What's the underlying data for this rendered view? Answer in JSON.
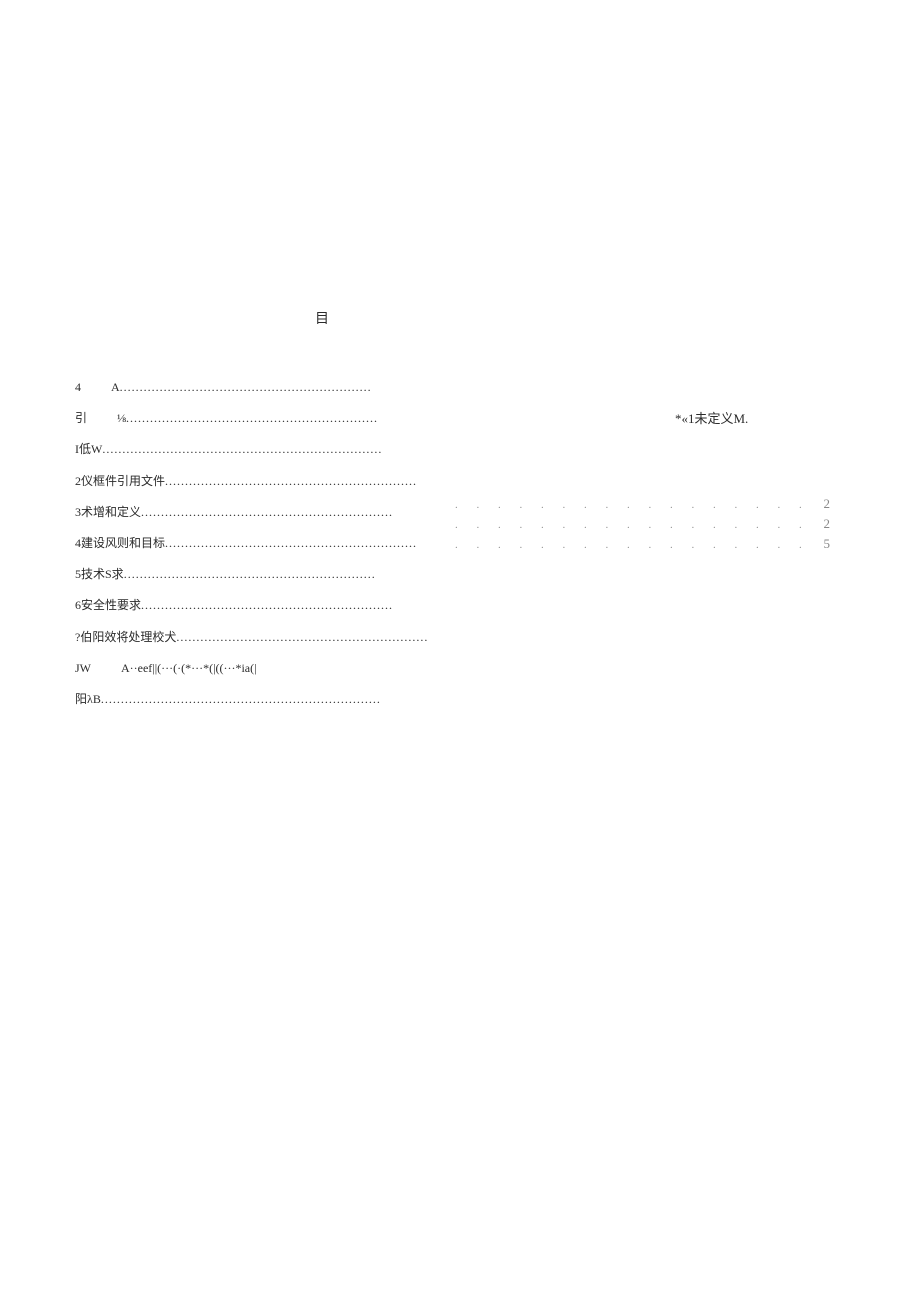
{
  "title": "目",
  "toc": {
    "row0": {
      "prefix": "4",
      "label": "A"
    },
    "row1": {
      "prefix": "引",
      "label": "⅛"
    },
    "row2": {
      "label": "I低W"
    },
    "row3": {
      "label": "2仪框件引用文件"
    },
    "row4": {
      "label": "3术增和定义"
    },
    "row5": {
      "label": "4建设风则和目标"
    },
    "row6": {
      "label": "5技术S求"
    },
    "row7": {
      "label": "6安全性要求"
    },
    "row8": {
      "label": "?伯阳效将处理校犬"
    },
    "row9": {
      "prefix": "JW",
      "label": "A··eef||(···(·(*···*(|((···*ia(|"
    },
    "row10": {
      "label": "阳λB"
    }
  },
  "right": {
    "note": "*«1未定义M.",
    "rows": [
      {
        "num": "2"
      },
      {
        "num": "2"
      },
      {
        "num": "5"
      }
    ]
  },
  "dots_short": "...............................................................",
  "dots_long": "..................................................................................................",
  "dots_sparse": ". . . . . . . . . . . . . . . . . . . . . . . . . . . . . . . . . . . . . . . ."
}
